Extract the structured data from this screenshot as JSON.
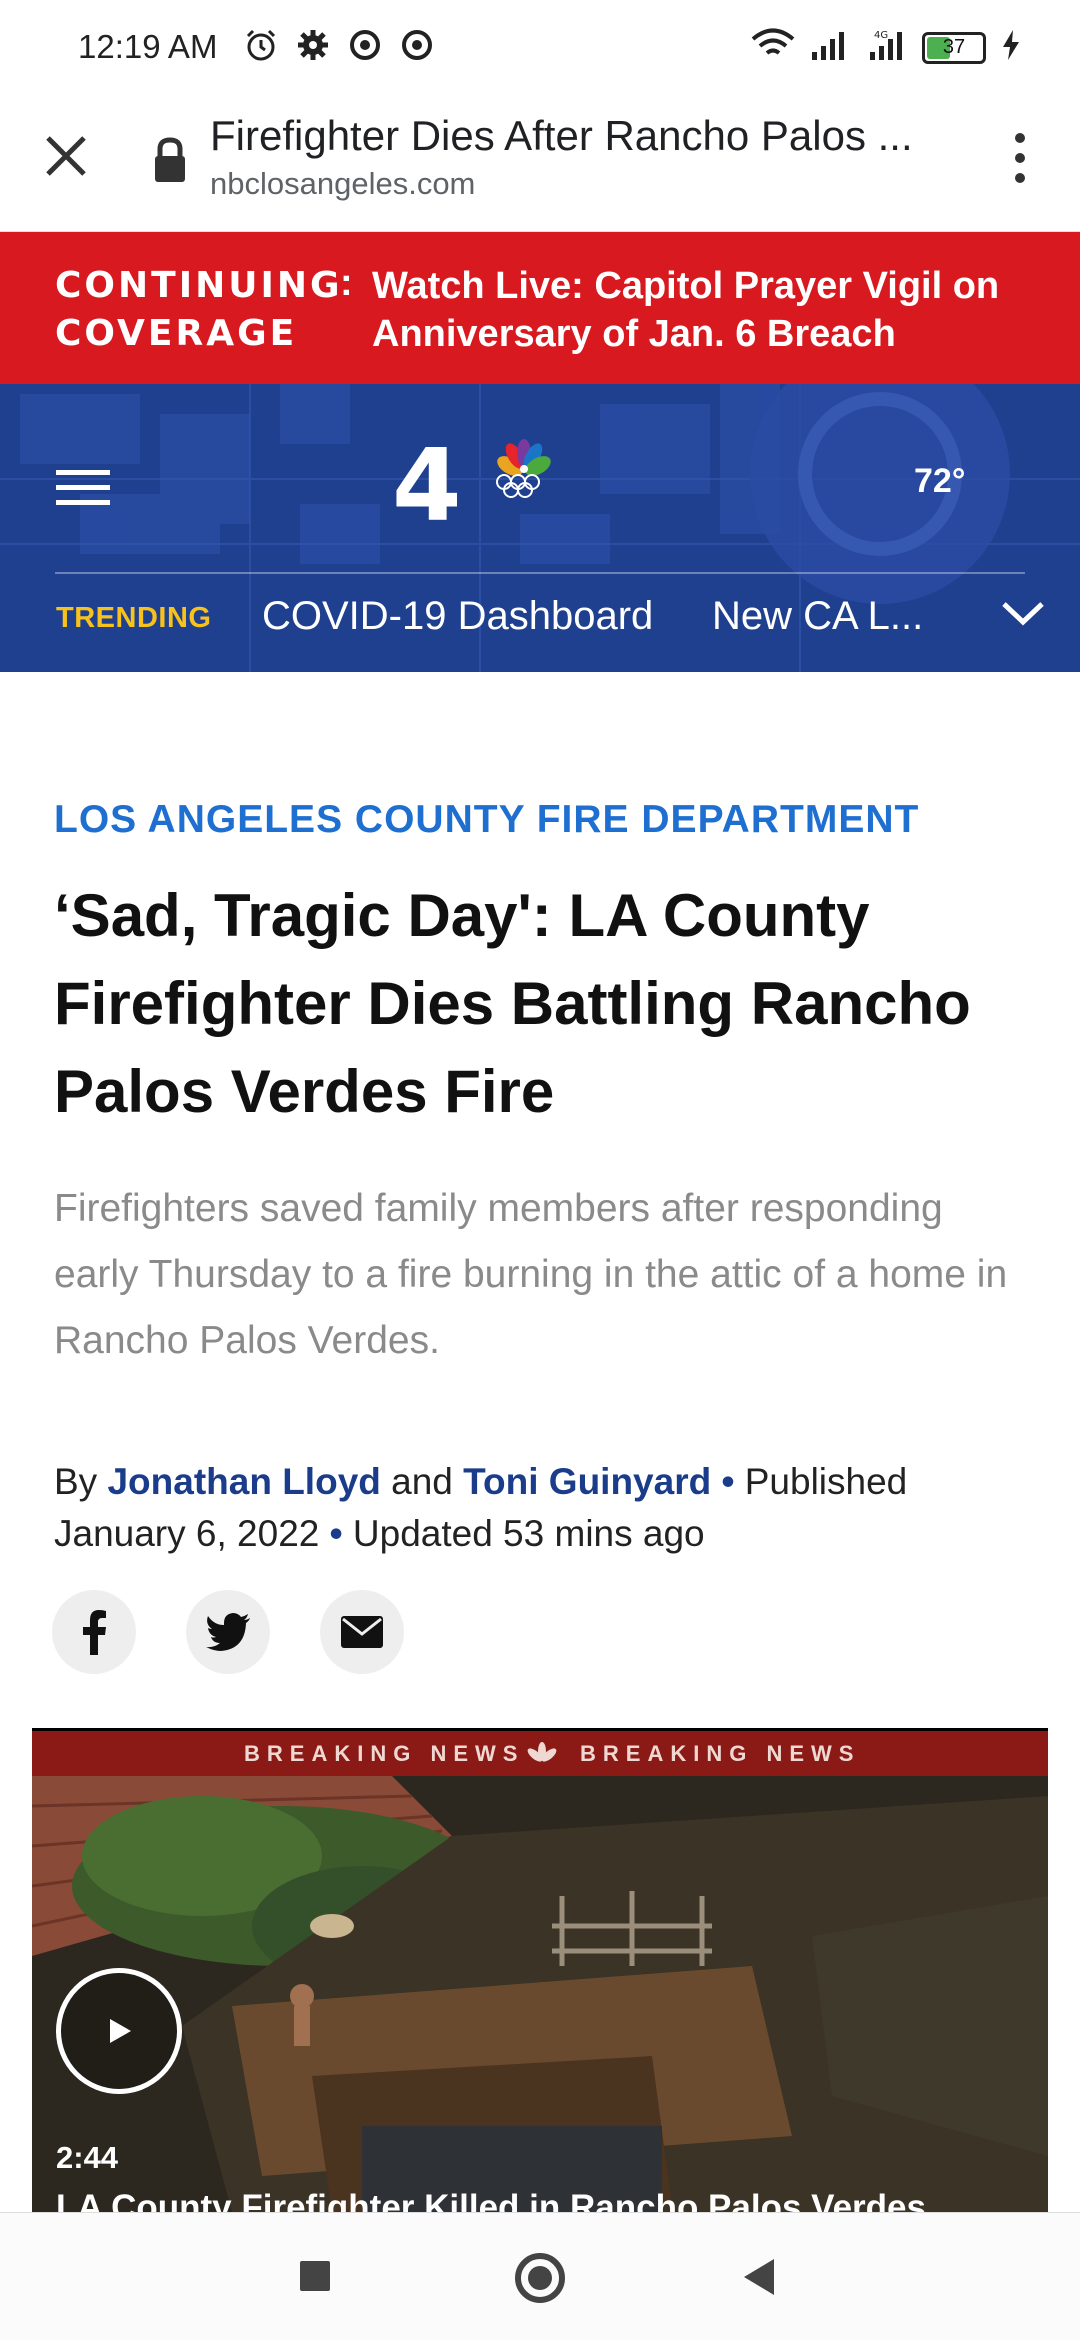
{
  "status_bar": {
    "time": "12:19 AM",
    "battery": "37",
    "left_icons": [
      "alarm-icon",
      "gear-icon",
      "data-saver-icon",
      "data-saver-icon"
    ],
    "right_icons": [
      "wifi-icon",
      "signal-icon",
      "signal-4g-icon",
      "battery-icon",
      "charging-icon"
    ]
  },
  "browser": {
    "title": "Firefighter Dies After Rancho Palos ...",
    "url": "nbclosangeles.com"
  },
  "coverage": {
    "label": "CONTINUING COVERAGE",
    "separator": ":",
    "text": "Watch Live: Capitol Prayer Vigil on Anniversary of Jan. 6 Breach"
  },
  "header": {
    "logo": "4",
    "temperature": "72°",
    "trending_label": "TRENDING",
    "trending": [
      "COVID-19 Dashboard",
      "New CA L..."
    ]
  },
  "article": {
    "section": "LOS ANGELES COUNTY FIRE DEPARTMENT",
    "headline": "‘Sad, Tragic Day': LA County Firefighter Dies Battling Rancho Palos Verdes Fire",
    "dek": "Firefighters saved family members after responding early Thursday to a fire burning in the attic of a home in Rancho Palos Verdes.",
    "byline": {
      "by": "By",
      "author1": "Jonathan Lloyd",
      "and": "and",
      "author2": "Toni Guinyard",
      "separator": "•",
      "published_label": "Published",
      "published_date": "January 6, 2022",
      "updated": "Updated 53 mins ago"
    },
    "share": [
      "facebook-icon",
      "twitter-icon",
      "email-icon"
    ]
  },
  "video": {
    "breaking": "BREAKING NEWS",
    "duration": "2:44",
    "title": "LA County Firefighter Killed in Rancho Palos Verdes"
  },
  "colors": {
    "coverage_red": "#d8191f",
    "header_blue": "#1f3f8f",
    "trending_yellow": "#f7c21b",
    "section_blue": "#1f6fd1",
    "author_blue": "#1a3c8a"
  }
}
